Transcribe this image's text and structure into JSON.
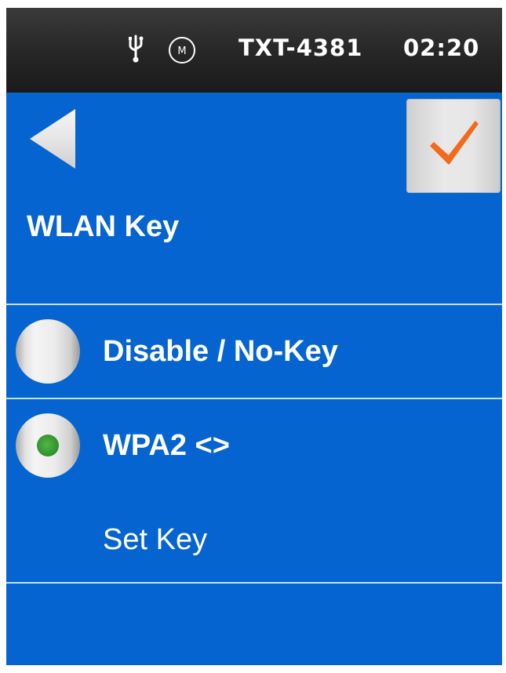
{
  "status_bar": {
    "usb_icon": "usb-icon",
    "mode_icon": "m-circle-icon",
    "mode_icon_letter": "M",
    "device_name": "TXT-4381",
    "time": "02:20"
  },
  "header": {
    "back_icon": "back-arrow-icon",
    "confirm_icon": "checkmark-icon",
    "title": "WLAN Key"
  },
  "options": [
    {
      "label": "Disable / No-Key",
      "selected": false
    },
    {
      "label": "WPA2 <>",
      "selected": true
    }
  ],
  "set_key_label": "Set Key",
  "colors": {
    "background": "#0564cf",
    "status_bar": "#262626",
    "checkmark": "#f26a1b",
    "radio_selected_dot": "#3fa33a",
    "divider": "#c9dcf4"
  }
}
